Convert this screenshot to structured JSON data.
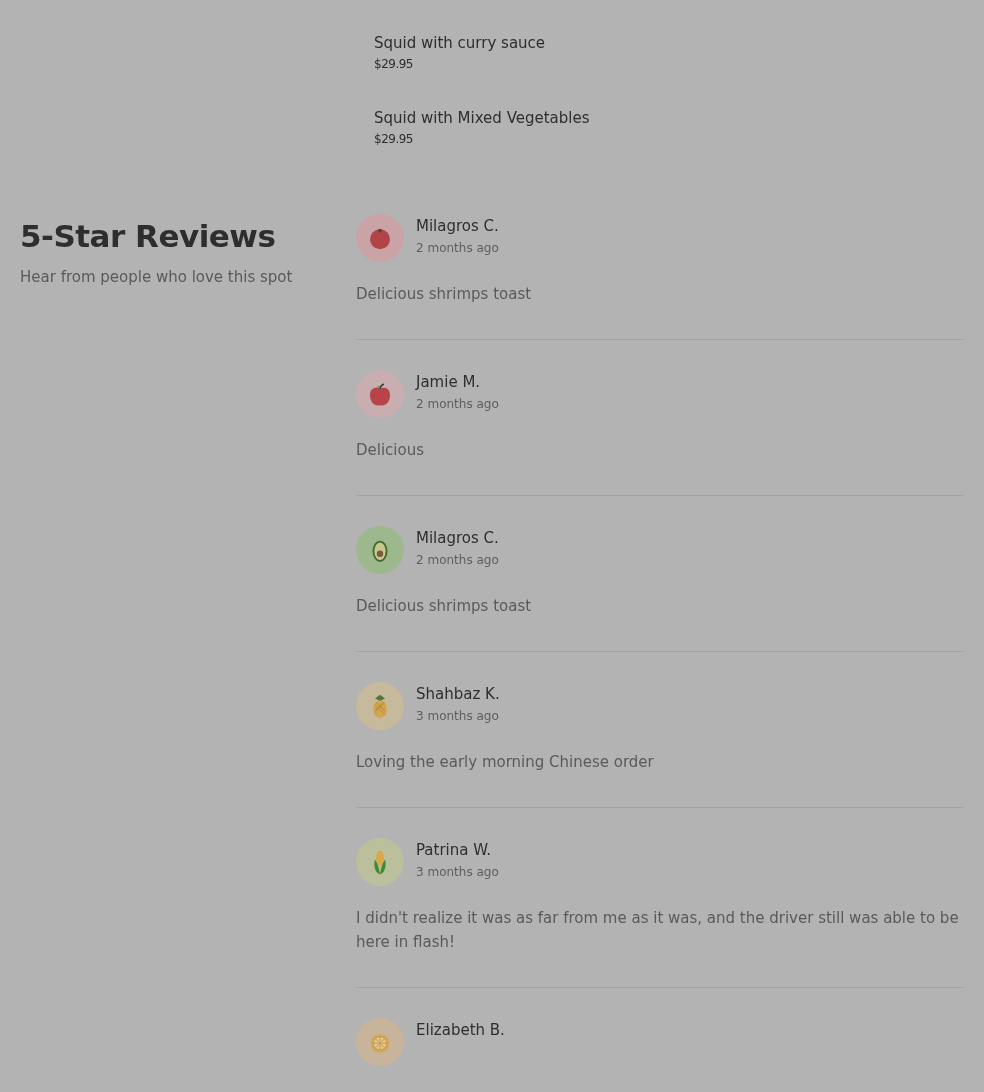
{
  "menu_items": [
    {
      "name": "Squid with curry sauce",
      "price": "$29.95"
    },
    {
      "name": "Squid with Mixed Vegetables",
      "price": "$29.95"
    }
  ],
  "reviews_section": {
    "title": "5-Star Reviews",
    "subtitle": "Hear from people who love this spot"
  },
  "reviews": [
    {
      "kind": "tomato",
      "author": "Milagros C.",
      "time": "2 months ago",
      "text": "Delicious shrimps toast"
    },
    {
      "kind": "apple",
      "author": "Jamie M.",
      "time": "2 months ago",
      "text": "Delicious"
    },
    {
      "kind": "avocado",
      "author": "Milagros C.",
      "time": "2 months ago",
      "text": "Delicious shrimps toast"
    },
    {
      "kind": "pineapple",
      "author": "Shahbaz K.",
      "time": "3 months ago",
      "text": "Loving the early morning Chinese order"
    },
    {
      "kind": "corn",
      "author": "Patrina W.",
      "time": "3 months ago",
      "text": "I didn't realize it was as far from me as it was, and the driver still was able to be here in flash!"
    },
    {
      "kind": "lemon",
      "author": "Elizabeth B."
    }
  ]
}
